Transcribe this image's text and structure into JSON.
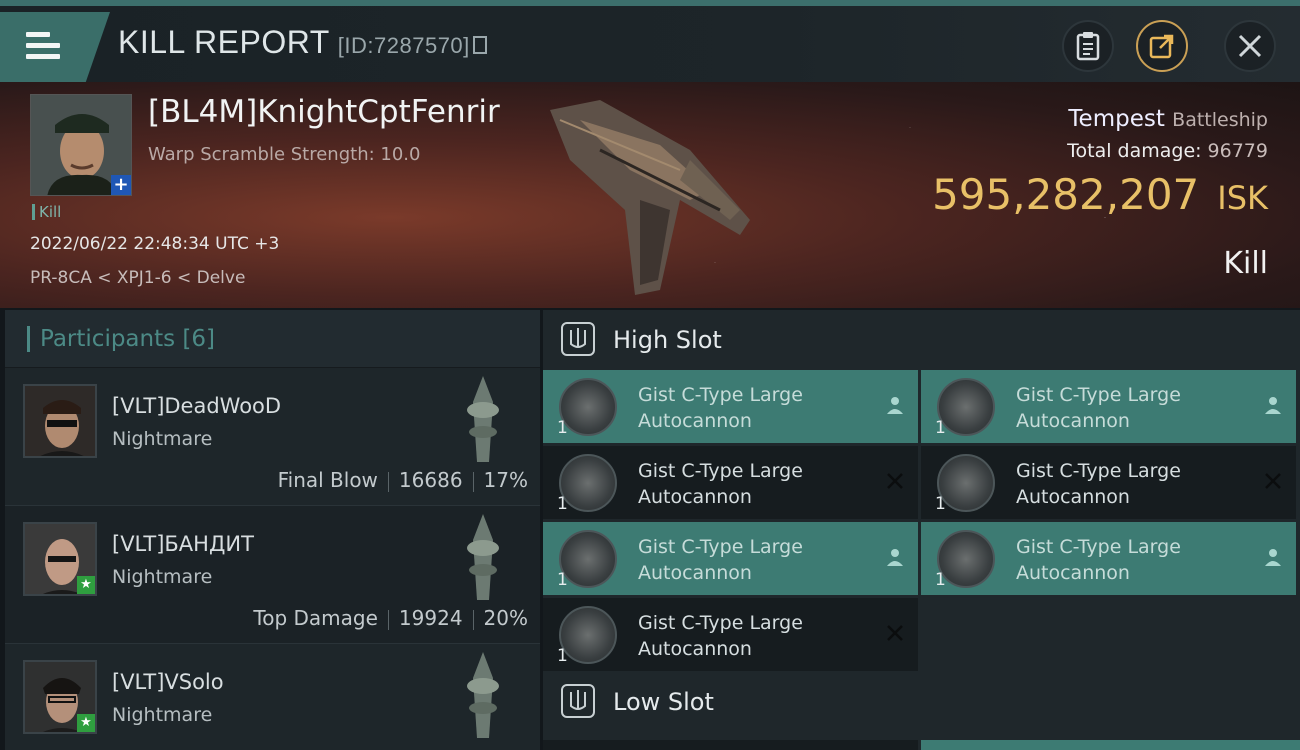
{
  "header": {
    "title": "KILL REPORT",
    "report_id": "[ID:7287570]",
    "buttons": [
      "clipboard",
      "share",
      "close"
    ]
  },
  "victim": {
    "name": "[BL4M]KnightCptFenrir",
    "warp": "Warp Scramble Strength: 10.0",
    "kill_tag": "Kill",
    "datetime": "2022/06/22 22:48:34 UTC +3",
    "location": "PR-8CA < XPJ1-6 < Delve",
    "ship_name": "Tempest",
    "ship_class": "Battleship",
    "total_damage_label": "Total damage:",
    "total_damage": "96779",
    "isk_value": "595,282,207",
    "isk_unit": "ISK",
    "result": "Kill"
  },
  "participants": {
    "title": "Participants",
    "count": "[6]",
    "rows": [
      {
        "name": "[VLT]DeadWooD",
        "ship": "Nightmare",
        "tag": "Final Blow",
        "damage": "16686",
        "percent": "17%"
      },
      {
        "name": "[VLT]БАНДИТ",
        "ship": "Nightmare",
        "tag": "Top Damage",
        "damage": "19924",
        "percent": "20%"
      },
      {
        "name": "[VLT]VSolo",
        "ship": "Nightmare",
        "tag": "",
        "damage": "",
        "percent": ""
      }
    ]
  },
  "modules": {
    "high_slot_title": "High Slot",
    "low_slot_title": "Low Slot",
    "items": [
      {
        "name": "Gist C-Type Large Autocannon",
        "qty": "1",
        "state": "dropped"
      },
      {
        "name": "Gist C-Type Large Autocannon",
        "qty": "1",
        "state": "dropped"
      },
      {
        "name": "Gist C-Type Large Autocannon",
        "qty": "1",
        "state": "destroyed"
      },
      {
        "name": "Gist C-Type Large Autocannon",
        "qty": "1",
        "state": "destroyed"
      },
      {
        "name": "Gist C-Type Large Autocannon",
        "qty": "1",
        "state": "dropped"
      },
      {
        "name": "Gist C-Type Large Autocannon",
        "qty": "1",
        "state": "dropped"
      },
      {
        "name": "Gist C-Type Large Autocannon",
        "qty": "1",
        "state": "destroyed"
      }
    ]
  },
  "colors": {
    "accent": "#3d7b73",
    "isk": "#e8c067",
    "teal_text": "#4c8a86"
  }
}
